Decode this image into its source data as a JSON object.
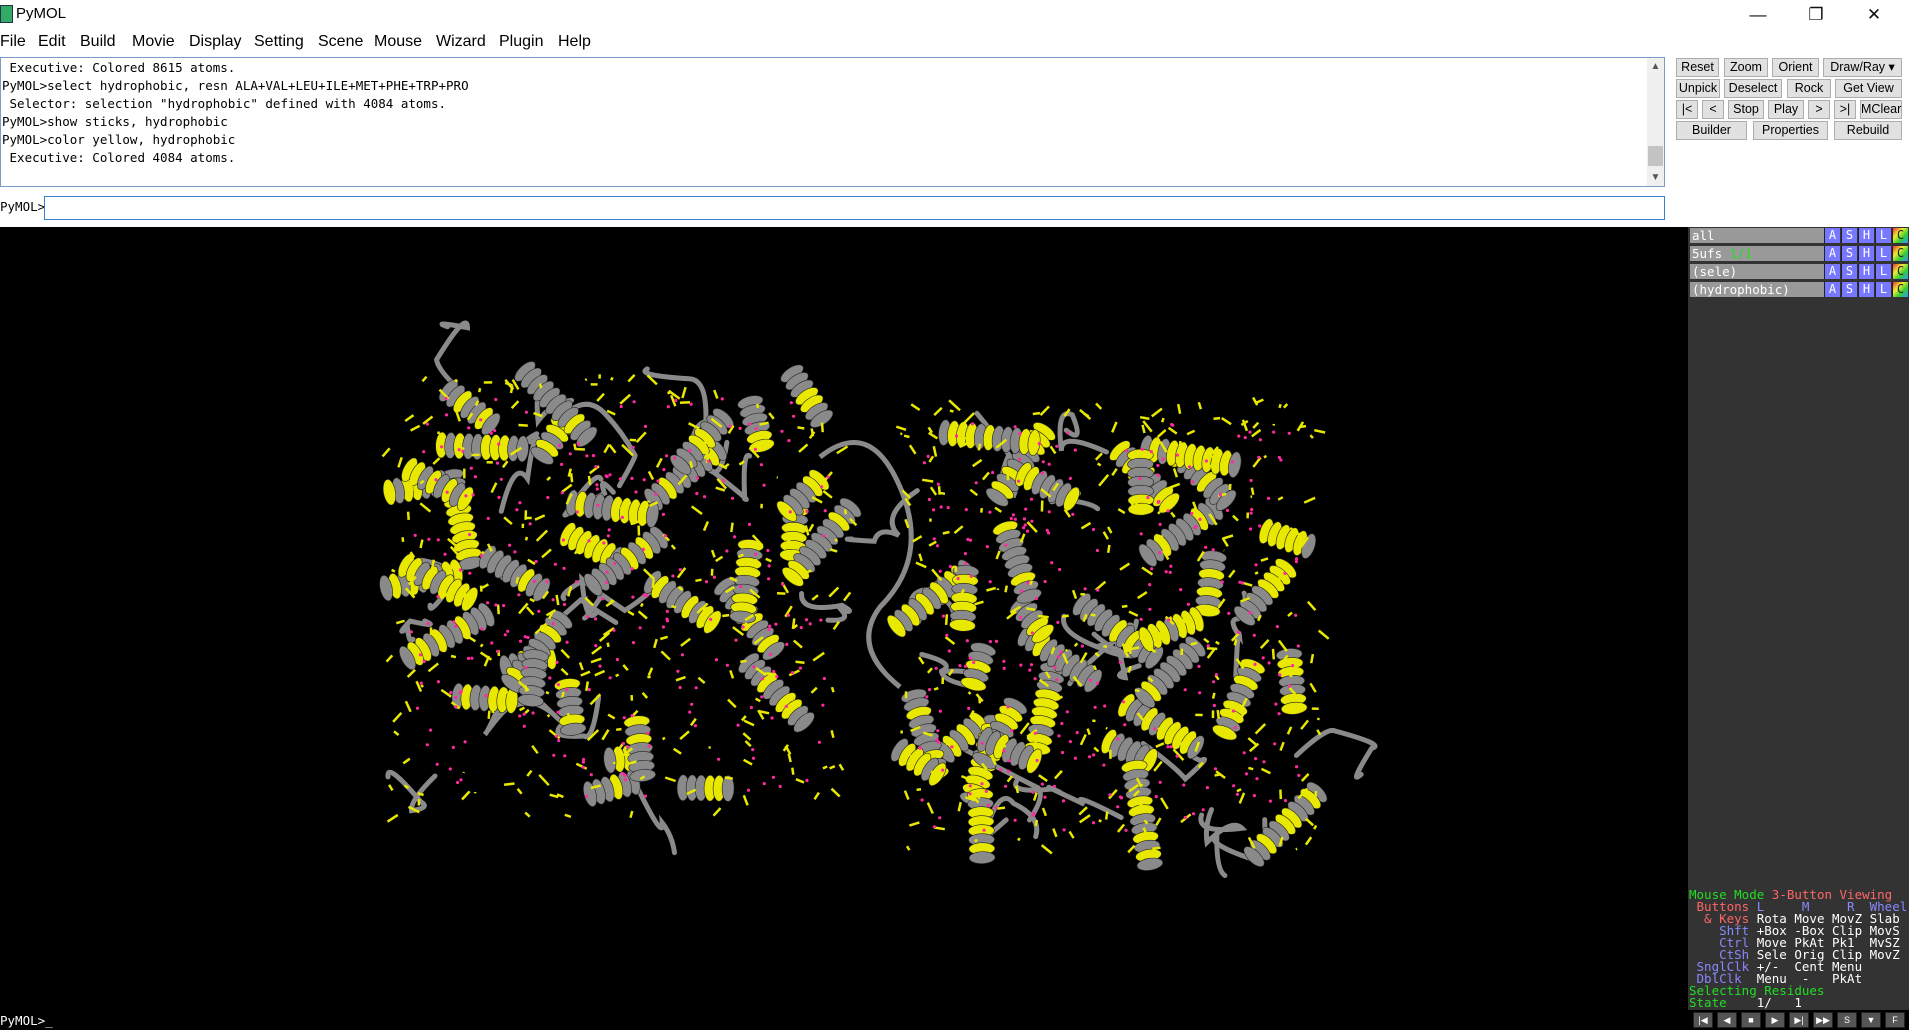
{
  "window": {
    "title": "PyMOL",
    "minimize": "—",
    "maximize": "❐",
    "close": "✕"
  },
  "menu": [
    "File",
    "Edit",
    "Build",
    "Movie",
    "Display",
    "Setting",
    "Scene",
    "Mouse",
    "Wizard",
    "Plugin",
    "Help"
  ],
  "console": {
    "lines": [
      " Executive: Colored 8615 atoms.",
      "PyMOL>select hydrophobic, resn ALA+VAL+LEU+ILE+MET+PHE+TRP+PRO",
      " Selector: selection \"hydrophobic\" defined with 4084 atoms.",
      "PyMOL>show sticks, hydrophobic",
      "PyMOL>color yellow, hydrophobic",
      " Executive: Colored 4084 atoms."
    ],
    "scroll_up": "▲",
    "scroll_down": "▼"
  },
  "command": {
    "label": "PyMOL>",
    "value": ""
  },
  "buttons": {
    "row1": [
      "Reset",
      "Zoom",
      "Orient",
      "Draw/Ray ▾"
    ],
    "row2": [
      "Unpick",
      "Deselect",
      "Rock",
      "Get View"
    ],
    "row3": [
      "|<",
      "<",
      "Stop",
      "Play",
      ">",
      ">|",
      "MClear"
    ],
    "row4": [
      "Builder",
      "Properties",
      "Rebuild"
    ]
  },
  "objects": [
    {
      "name": "all",
      "state": ""
    },
    {
      "name": "5ufs",
      "state": " 1/1"
    },
    {
      "name": "(sele)",
      "state": ""
    },
    {
      "name": "(hydrophobic)",
      "state": ""
    }
  ],
  "object_buttons": [
    "A",
    "S",
    "H",
    "L",
    "C"
  ],
  "mouse_info": [
    [
      {
        "t": "Mouse Mode ",
        "c": "#2d2"
      },
      {
        "t": "3-Button Viewing",
        "c": "#f66"
      }
    ],
    [
      {
        "t": " Buttons ",
        "c": "#f66"
      },
      {
        "t": "L     M     R  Wheel",
        "c": "#88f"
      }
    ],
    [
      {
        "t": "  & Keys ",
        "c": "#f66"
      },
      {
        "t": "Rota Move MovZ Slab",
        "c": "#fff"
      }
    ],
    [
      {
        "t": "    Shft ",
        "c": "#88f"
      },
      {
        "t": "+Box -Box Clip MovS",
        "c": "#fff"
      }
    ],
    [
      {
        "t": "    Ctrl ",
        "c": "#88f"
      },
      {
        "t": "Move PkAt Pk1  MvSZ",
        "c": "#fff"
      }
    ],
    [
      {
        "t": "    CtSh ",
        "c": "#88f"
      },
      {
        "t": "Sele Orig Clip MovZ",
        "c": "#fff"
      }
    ],
    [
      {
        "t": " SnglClk ",
        "c": "#88f"
      },
      {
        "t": "+/-  Cent Menu",
        "c": "#fff"
      }
    ],
    [
      {
        "t": " DblClk  ",
        "c": "#88f"
      },
      {
        "t": "Menu  -   PkAt",
        "c": "#fff"
      }
    ],
    [
      {
        "t": "Selecting Residues",
        "c": "#2d2"
      }
    ],
    [
      {
        "t": "State ",
        "c": "#2d2"
      },
      {
        "t": "   1/   1",
        "c": "#fff"
      }
    ]
  ],
  "bottom_prompt": "PyMOL>_",
  "playback": [
    "|◀",
    "◀",
    "■",
    "▶",
    "▶|",
    "▶▶",
    "S",
    "▼",
    "F"
  ],
  "colors": {
    "cartoon": "#8a8a8a",
    "sticks": "#e8e800",
    "atoms": "#ff2aa0",
    "viewport_bg": "#000000"
  }
}
